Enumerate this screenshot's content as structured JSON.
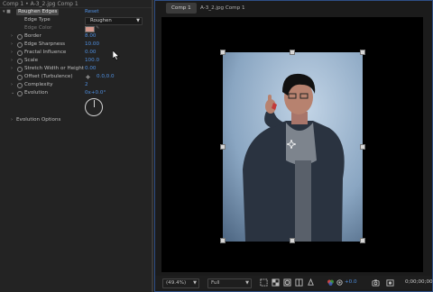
{
  "effect_panel": {
    "title": "Comp 1 • A-3_2.jpg Comp 1",
    "effect": {
      "toggle": "fx",
      "name": "Roughen Edges",
      "reset_label": "Reset"
    },
    "properties": [
      {
        "label": "Edge Type",
        "value": "Roughen",
        "kind": "select"
      },
      {
        "label": "Edge Color",
        "value": "",
        "kind": "color",
        "color": "#d69a8e"
      },
      {
        "label": "Border",
        "value": "8.00",
        "kind": "number"
      },
      {
        "label": "Edge Sharpness",
        "value": "10.00",
        "kind": "number"
      },
      {
        "label": "Fractal Influence",
        "value": "0.00",
        "kind": "number"
      },
      {
        "label": "Scale",
        "value": "100.0",
        "kind": "number"
      },
      {
        "label": "Stretch Width or Height",
        "value": "0.00",
        "kind": "number"
      },
      {
        "label": "Offset (Turbulence)",
        "value": "0.0,0.0",
        "kind": "point"
      },
      {
        "label": "Complexity",
        "value": "2",
        "kind": "number"
      },
      {
        "label": "Evolution",
        "value": "0x+0.0°",
        "kind": "angle"
      }
    ],
    "evolution_options_label": "Evolution Options"
  },
  "composition_panel": {
    "tab_label": "Comp 1",
    "breadcrumb": "A-3_2.jpg Comp 1",
    "colors": {
      "accent": "#4f8fe0",
      "viewer_bg": "#000000",
      "image_backdrop": "#8aa6c2"
    },
    "toolbar": {
      "zoom": "(49.4%)",
      "resolution": "Full",
      "exposure": "+0.0",
      "timecode": "0;00;00;00",
      "icons": [
        "region-of-interest-icon",
        "transparency-grid-icon",
        "mask-visibility-icon",
        "guides-icon",
        "color-management-icon",
        "reset-exposure-icon",
        "snapshot-icon",
        "show-snapshot-icon"
      ]
    }
  }
}
